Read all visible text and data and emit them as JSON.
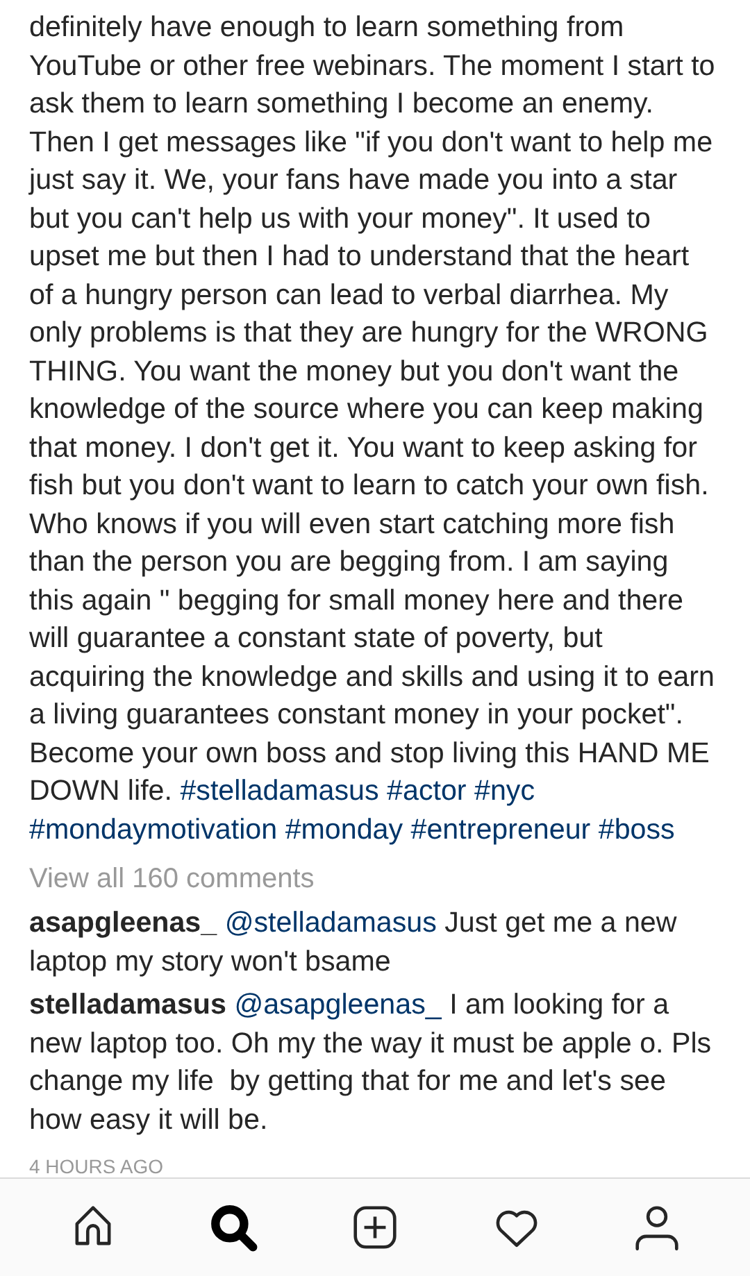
{
  "caption": {
    "text": "definitely have enough to learn something from YouTube or other free webinars. The moment I start to ask them to learn something I become an enemy. Then I get messages like \"if you don't want to help me just say it. We,  your fans have made you into a star but you can't help us with your money\". It used to upset me but then I had to understand that the heart of a hungry person can lead to verbal diarrhea. My only problems is that they are hungry for the WRONG THING. You want the money but you don't want the knowledge of the source where you can keep making that money. I don't get it. You want to keep asking for fish but you don't want to learn to catch your own fish. Who knows if you will even start catching more fish than the person you are begging from. I am saying this again \" begging for small money here and there will guarantee a constant state of poverty, but acquiring the knowledge and skills and using it to earn a living guarantees constant money in your pocket\". Become your own boss and stop living this HAND ME DOWN life.",
    "hashtags": [
      "#stelladamasus",
      "#actor",
      "#nyc",
      "#mondaymotivation",
      "#monday",
      "#entrepreneur",
      "#boss"
    ]
  },
  "view_all": "View all 160 comments",
  "comments": [
    {
      "username": "asapgleenas_",
      "mention": "@stelladamasus",
      "text": "Just get me a new laptop my story won't bsame"
    },
    {
      "username": "stelladamasus",
      "mention": "@asapgleenas_",
      "text": "I am looking for a new laptop too. Oh my the way it must be apple o. Pls change my life  by getting that for me and let's see how easy it will be."
    }
  ],
  "timestamp": "4 HOURS AGO",
  "nav": [
    {
      "kind": "home",
      "selected": false
    },
    {
      "kind": "search",
      "selected": true
    },
    {
      "kind": "add",
      "selected": false
    },
    {
      "kind": "heart",
      "selected": false
    },
    {
      "kind": "profile",
      "selected": false
    }
  ]
}
